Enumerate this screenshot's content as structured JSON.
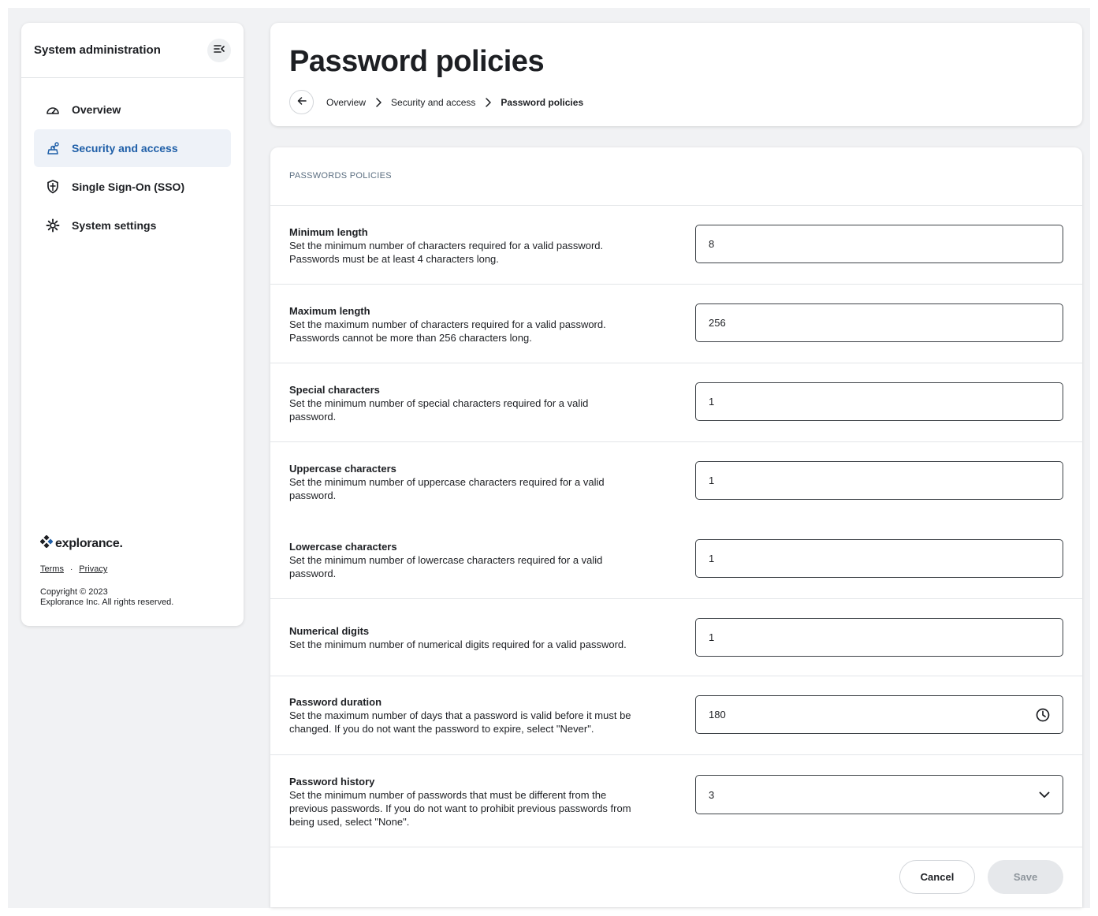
{
  "sidebar": {
    "title": "System administration",
    "collapse_icon": "collapse-menu-icon",
    "items": [
      {
        "label": "Overview",
        "icon": "dashboard-gauge-icon",
        "active": false
      },
      {
        "label": "Security and access",
        "icon": "security-access-icon",
        "active": true
      },
      {
        "label": "Single Sign-On (SSO)",
        "icon": "shield-icon",
        "active": false
      },
      {
        "label": "System settings",
        "icon": "gear-icon",
        "active": false
      }
    ],
    "footer": {
      "logo_text": "explorance.",
      "terms": "Terms",
      "separator": "·",
      "privacy": "Privacy",
      "copyright_line1": "Copyright © 2023",
      "copyright_line2": "Explorance Inc. All rights reserved."
    }
  },
  "header": {
    "title": "Password policies",
    "breadcrumb": [
      "Overview",
      "Security and access",
      "Password policies"
    ]
  },
  "main": {
    "section_title": "PASSWORDS POLICIES",
    "settings": [
      {
        "name": "Minimum length",
        "desc_line1": "Set the minimum number of characters required for a valid password.",
        "desc_line2": "Passwords must be at least 4 characters long.",
        "desc_line3": "",
        "value": "8",
        "control": "text"
      },
      {
        "name": "Maximum length",
        "desc_line1": "Set the maximum number of characters required for a valid password.",
        "desc_line2": "Passwords cannot be more than 256 characters long.",
        "desc_line3": "",
        "value": "256",
        "control": "text"
      },
      {
        "name": "Special characters",
        "desc_line1": "Set the minimum number of special characters required for a valid",
        "desc_line2": "password.",
        "desc_line3": "",
        "value": "1",
        "control": "text"
      },
      {
        "name": "Uppercase characters",
        "desc_line1": "Set the minimum number of uppercase characters required for a valid",
        "desc_line2": "password.",
        "desc_line3": "",
        "value": "1",
        "control": "text"
      },
      {
        "name": "Lowercase characters",
        "desc_line1": "Set the minimum number of lowercase characters required for a valid",
        "desc_line2": "password.",
        "desc_line3": "",
        "value": "1",
        "control": "text"
      },
      {
        "name": "Numerical digits",
        "desc_line1": "Set the minimum number of numerical digits required for a valid password.",
        "desc_line2": "",
        "desc_line3": "",
        "value": "1",
        "control": "text"
      },
      {
        "name": "Password duration",
        "desc_line1": "Set the maximum number of days that a password is valid before it must be",
        "desc_line2": "changed. If you do not want the password to expire, select \"Never\".",
        "desc_line3": "",
        "value": "180",
        "control": "time",
        "suffix_icon": "clock-icon"
      },
      {
        "name": "Password history",
        "desc_line1": "Set the minimum number of passwords that must be different from the",
        "desc_line2": "previous passwords. If you do not want to prohibit previous passwords from",
        "desc_line3": "being used, select \"None\".",
        "value": "3",
        "control": "select",
        "suffix_icon": "chevron-down-icon"
      }
    ],
    "cancel_label": "Cancel",
    "save_label": "Save"
  },
  "colors": {
    "accent": "#1f5fa8",
    "active_bg": "#eef2f8",
    "section_title": "#5b6e80",
    "disabled_btn_bg": "#e6e8eb"
  }
}
